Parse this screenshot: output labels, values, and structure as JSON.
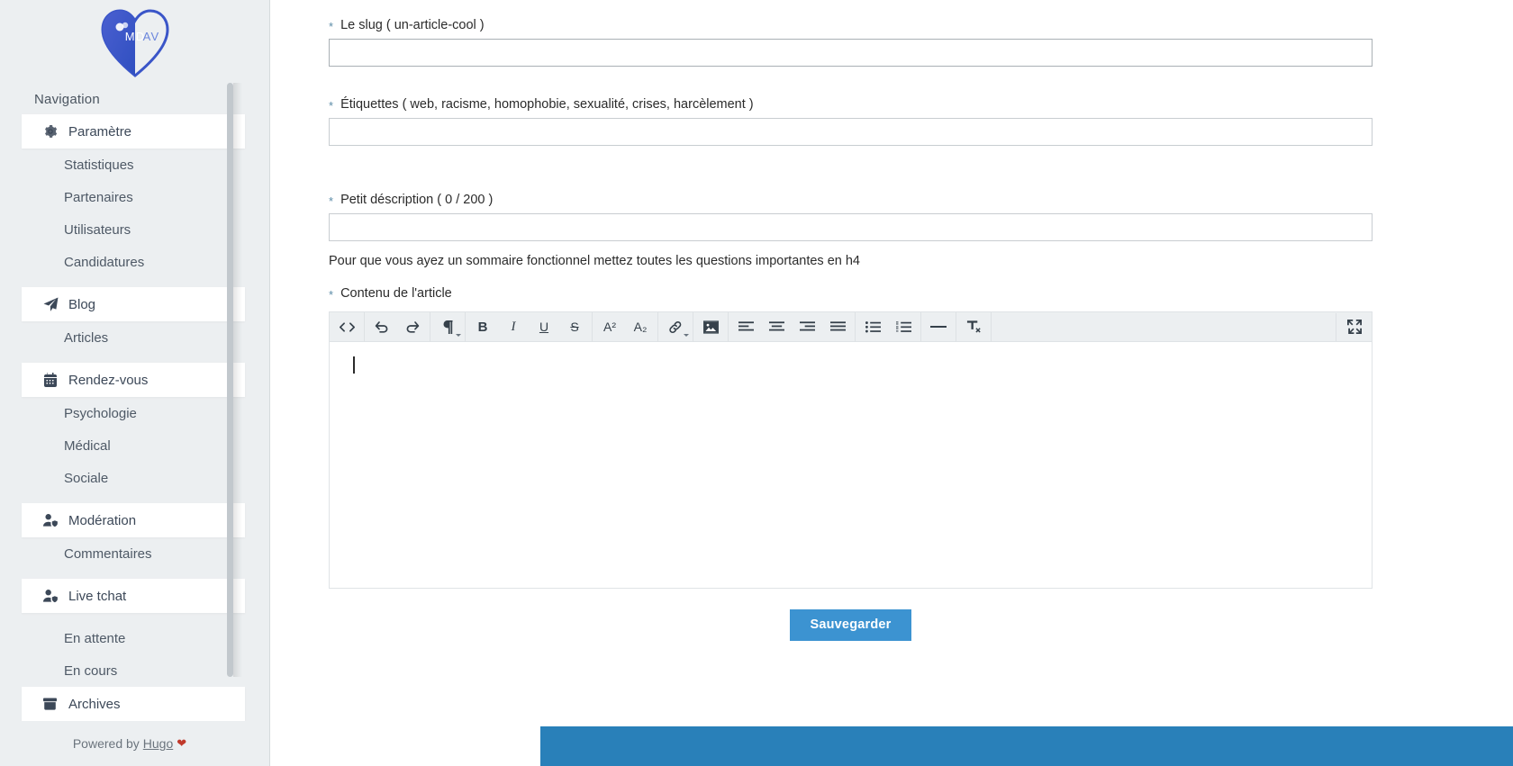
{
  "sidebar": {
    "logo_alt": "MDAV heart logo",
    "nav_title": "Navigation",
    "items": [
      {
        "label": "Paramètre",
        "icon": "gear-icon",
        "type": "parent"
      },
      {
        "label": "Statistiques",
        "icon": "",
        "type": "child"
      },
      {
        "label": "Partenaires",
        "icon": "",
        "type": "child"
      },
      {
        "label": "Utilisateurs",
        "icon": "",
        "type": "child"
      },
      {
        "label": "Candidatures",
        "icon": "",
        "type": "child"
      },
      {
        "label": "Blog",
        "icon": "paper-plane-icon",
        "type": "parent"
      },
      {
        "label": "Articles",
        "icon": "",
        "type": "child"
      },
      {
        "label": "Rendez-vous",
        "icon": "calendar-icon",
        "type": "parent"
      },
      {
        "label": "Psychologie",
        "icon": "",
        "type": "child"
      },
      {
        "label": "Médical",
        "icon": "",
        "type": "child"
      },
      {
        "label": "Sociale",
        "icon": "",
        "type": "child"
      },
      {
        "label": "Modération",
        "icon": "user-shield-icon",
        "type": "parent"
      },
      {
        "label": "Commentaires",
        "icon": "",
        "type": "child"
      },
      {
        "label": "Live tchat",
        "icon": "user-shield-icon",
        "type": "parent"
      },
      {
        "label": "En attente",
        "icon": "",
        "type": "child"
      },
      {
        "label": "En cours",
        "icon": "",
        "type": "child"
      },
      {
        "label": "Archives",
        "icon": "archive-icon",
        "type": "parent"
      }
    ],
    "footer": {
      "prefix": "Powered by",
      "link": "Hugo",
      "heart": "❤"
    }
  },
  "form": {
    "slug": {
      "required_mark": "*",
      "label": "Le slug ( un-article-cool )",
      "value": "",
      "placeholder": ""
    },
    "tags": {
      "required_mark": "*",
      "label": "Étiquettes ( web, racisme, homophobie, sexualité, crises, harcèlement )",
      "value": "",
      "placeholder": ""
    },
    "description": {
      "required_mark": "*",
      "label": "Petit déscription ( 0 / 200 )",
      "value": "",
      "placeholder": "",
      "char_count": 0,
      "char_max": 200
    },
    "hint": "Pour que vous ayez un sommaire fonctionnel mettez toutes les questions importantes en h4",
    "content": {
      "required_mark": "*",
      "label": "Contenu de l'article",
      "value": ""
    },
    "save_label": "Sauvegarder"
  },
  "editor_toolbar": {
    "groups": [
      {
        "buttons": [
          {
            "name": "source-code-icon",
            "glyph": "<>"
          }
        ]
      },
      {
        "buttons": [
          {
            "name": "undo-icon",
            "glyph": "↩"
          },
          {
            "name": "redo-icon",
            "glyph": "↪"
          }
        ]
      },
      {
        "buttons": [
          {
            "name": "paragraph-format-icon",
            "glyph": "¶",
            "has_caret": true
          }
        ]
      },
      {
        "buttons": [
          {
            "name": "bold-icon",
            "glyph": "B"
          },
          {
            "name": "italic-icon",
            "glyph": "I"
          },
          {
            "name": "underline-icon",
            "glyph": "U"
          },
          {
            "name": "strikethrough-icon",
            "glyph": "S"
          }
        ]
      },
      {
        "buttons": [
          {
            "name": "superscript-icon",
            "glyph": "A²"
          },
          {
            "name": "subscript-icon",
            "glyph": "A₂"
          }
        ]
      },
      {
        "buttons": [
          {
            "name": "link-icon",
            "glyph": "🔗",
            "has_caret": true
          }
        ]
      },
      {
        "buttons": [
          {
            "name": "image-icon",
            "glyph": "🖼"
          }
        ]
      },
      {
        "buttons": [
          {
            "name": "align-left-icon",
            "glyph": ""
          },
          {
            "name": "align-center-icon",
            "glyph": ""
          },
          {
            "name": "align-right-icon",
            "glyph": ""
          },
          {
            "name": "align-justify-icon",
            "glyph": ""
          }
        ]
      },
      {
        "buttons": [
          {
            "name": "unordered-list-icon",
            "glyph": ""
          },
          {
            "name": "ordered-list-icon",
            "glyph": ""
          }
        ]
      },
      {
        "buttons": [
          {
            "name": "horizontal-rule-icon",
            "glyph": "—"
          }
        ]
      },
      {
        "buttons": [
          {
            "name": "clear-formatting-icon",
            "glyph": "Tx"
          }
        ]
      }
    ],
    "fullscreen": {
      "name": "fullscreen-icon"
    }
  },
  "colors": {
    "sidebar_bg": "#eceff1",
    "accent_blue": "#3c93d1",
    "footer_blue": "#2980b9",
    "text": "#2b2b2b",
    "required": "#5c8ca8",
    "heart_red": "#c0392b"
  }
}
